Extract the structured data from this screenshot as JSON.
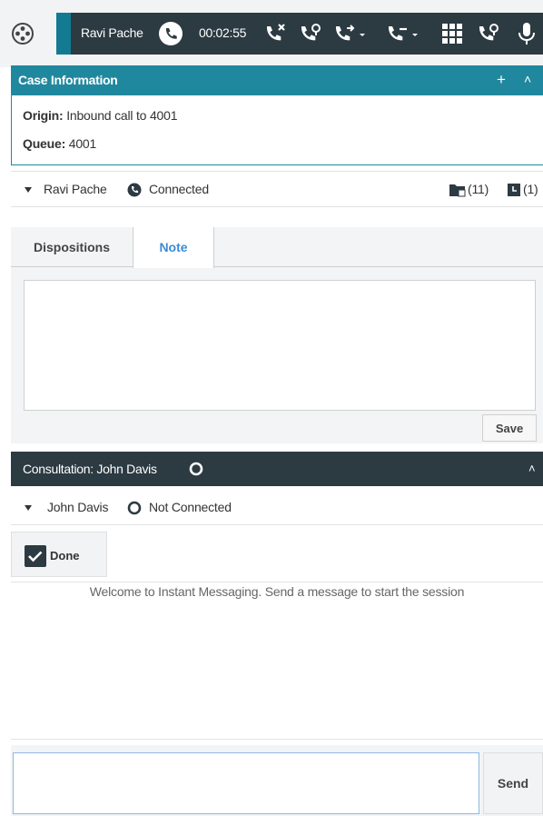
{
  "toolbar": {
    "home_icon": "target-icon",
    "caller_name": "Ravi Pache",
    "timer": "00:02:55",
    "icons": [
      "phone-icon",
      "end-call-icon",
      "hold-icon",
      "transfer-icon",
      "conference-icon",
      "dialpad-icon",
      "voicemail-icon",
      "microphone-icon"
    ],
    "accent_color": "#2c3a42",
    "stripe_color": "#127b92"
  },
  "case_info": {
    "title": "Case Information",
    "add_label": "+",
    "collapse_label": "˄",
    "origin_label": "Origin:",
    "origin_value": "Inbound call to 4001",
    "queue_label": "Queue:",
    "queue_value": "4001",
    "header_color": "#20889e"
  },
  "party": {
    "name": "Ravi Pache",
    "status": "Connected",
    "folder_count": "(11)",
    "history_count": "(1)"
  },
  "tabs": {
    "dispositions_label": "Dispositions",
    "note_label": "Note",
    "note_value": "",
    "save_label": "Save"
  },
  "consultation": {
    "title": "Consultation: John Davis",
    "collapse_label": "˄",
    "party_name": "John Davis",
    "party_status": "Not Connected"
  },
  "im": {
    "done_label": "Done",
    "welcome_text": "Welcome to Instant Messaging. Send a message to start the session",
    "input_value": "",
    "send_label": "Send"
  }
}
